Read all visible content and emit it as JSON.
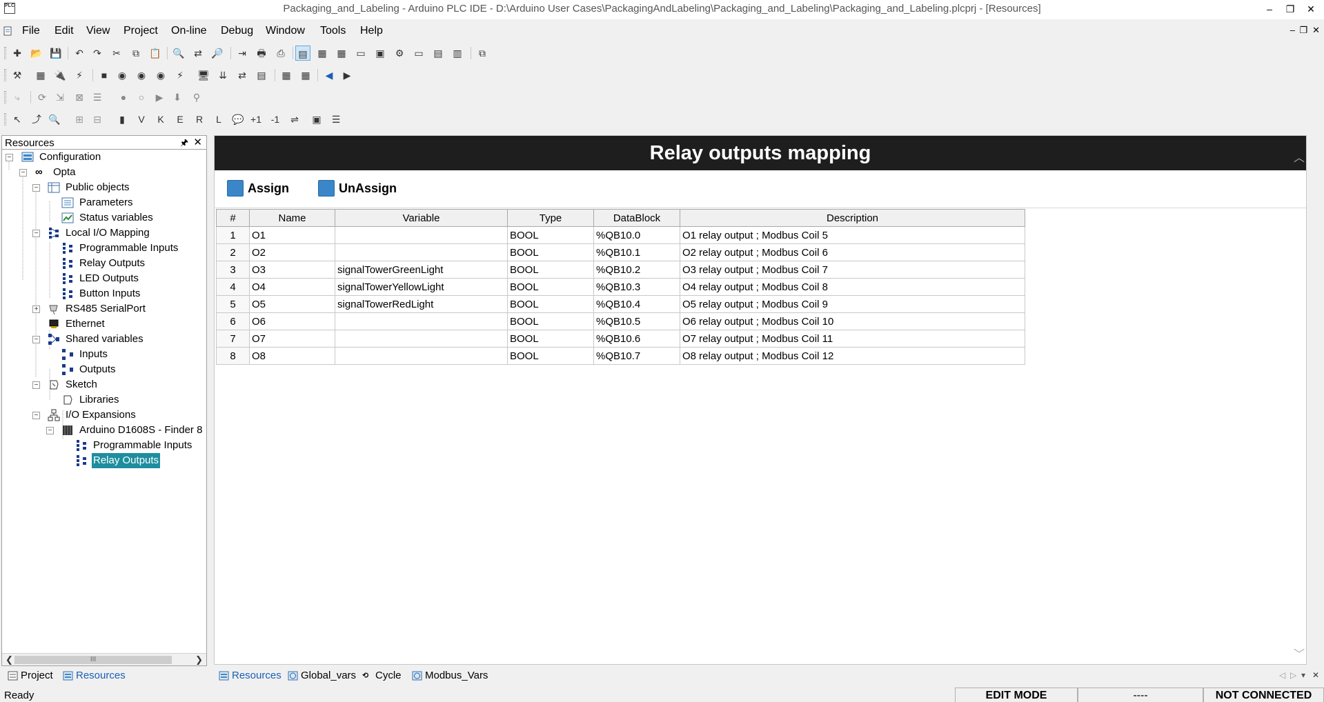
{
  "window": {
    "title": "Packaging_and_Labeling - Arduino PLC IDE - D:\\Arduino User Cases\\PackagingAndLabeling\\Packaging_and_Labeling\\Packaging_and_Labeling.plcprj - [Resources]",
    "app_icon_text": "PLC",
    "controls": {
      "minimize": "–",
      "restore": "❐",
      "close": "✕"
    },
    "mdi_controls": {
      "minimize": "–",
      "restore": "❐",
      "close": "✕"
    }
  },
  "menu": [
    "File",
    "Edit",
    "View",
    "Project",
    "On-line",
    "Debug",
    "Window",
    "Tools",
    "Help"
  ],
  "resources_panel": {
    "title": "Resources",
    "pin": "🖈",
    "close": "✕",
    "tree": [
      {
        "label": "Configuration",
        "icon": "configuration-icon"
      },
      {
        "label": "Opta",
        "icon": "infinity-icon"
      },
      {
        "label": "Public objects",
        "icon": "table-icon"
      },
      {
        "label": "Parameters",
        "icon": "list-icon"
      },
      {
        "label": "Status variables",
        "icon": "status-vars-icon"
      },
      {
        "label": "Local I/O Mapping",
        "icon": "io-mapping-icon"
      },
      {
        "label": "Programmable Inputs",
        "icon": "io-mapping-icon"
      },
      {
        "label": "Relay Outputs",
        "icon": "io-mapping-icon"
      },
      {
        "label": "LED Outputs",
        "icon": "io-mapping-icon"
      },
      {
        "label": "Button Inputs",
        "icon": "io-mapping-icon"
      },
      {
        "label": "RS485 SerialPort",
        "icon": "serial-port-icon"
      },
      {
        "label": "Ethernet",
        "icon": "ethernet-icon"
      },
      {
        "label": "Shared variables",
        "icon": "shared-vars-icon"
      },
      {
        "label": "Inputs",
        "icon": "shared-vars-icon"
      },
      {
        "label": "Outputs",
        "icon": "shared-vars-icon"
      },
      {
        "label": "Sketch",
        "icon": "sketch-icon"
      },
      {
        "label": "Libraries",
        "icon": "sketch-icon"
      },
      {
        "label": "I/O Expansions",
        "icon": "network-icon"
      },
      {
        "label": "Arduino D1608S - Finder 8",
        "icon": "module-icon"
      },
      {
        "label": "Programmable Inputs",
        "icon": "io-mapping-icon"
      },
      {
        "label": "Relay Outputs",
        "icon": "io-mapping-icon",
        "selected": true
      }
    ],
    "scroll_thumb": "III"
  },
  "left_tabs": [
    {
      "label": "Project",
      "icon": "project-icon"
    },
    {
      "label": "Resources",
      "icon": "resources-icon",
      "active": true
    }
  ],
  "editor": {
    "heading": "Relay outputs mapping",
    "assign_label": "Assign",
    "unassign_label": "UnAssign",
    "columns": [
      "#",
      "Name",
      "Variable",
      "Type",
      "DataBlock",
      "Description"
    ],
    "rows": [
      [
        "1",
        "O1",
        "",
        "BOOL",
        "%QB10.0",
        "O1 relay output ; Modbus Coil 5"
      ],
      [
        "2",
        "O2",
        "",
        "BOOL",
        "%QB10.1",
        "O2 relay output ; Modbus Coil 6"
      ],
      [
        "3",
        "O3",
        "signalTowerGreenLight",
        "BOOL",
        "%QB10.2",
        "O3 relay output ; Modbus Coil 7"
      ],
      [
        "4",
        "O4",
        "signalTowerYellowLight",
        "BOOL",
        "%QB10.3",
        "O4 relay output ; Modbus Coil 8"
      ],
      [
        "5",
        "O5",
        "signalTowerRedLight",
        "BOOL",
        "%QB10.4",
        "O5 relay output ; Modbus Coil 9"
      ],
      [
        "6",
        "O6",
        "",
        "BOOL",
        "%QB10.5",
        "O6 relay output ; Modbus Coil 10"
      ],
      [
        "7",
        "O7",
        "",
        "BOOL",
        "%QB10.6",
        "O7 relay output ; Modbus Coil 11"
      ],
      [
        "8",
        "O8",
        "",
        "BOOL",
        "%QB10.7",
        "O8 relay output ; Modbus Coil 12"
      ]
    ]
  },
  "doc_tabs": [
    {
      "label": "Resources",
      "icon": "resources-icon",
      "active": true
    },
    {
      "label": "Global_vars",
      "icon": "globe-icon"
    },
    {
      "label": "Cycle",
      "icon": "cycle-icon"
    },
    {
      "label": "Modbus_Vars",
      "icon": "globe-icon"
    }
  ],
  "doc_tab_nav": {
    "prev": "◁",
    "next": "▷",
    "menu": "▾",
    "close": "✕"
  },
  "status": {
    "text": "Ready",
    "mode": "EDIT MODE",
    "middle": "----",
    "connection": "NOT CONNECTED"
  },
  "colors": {
    "selection": "#1e8e9e",
    "banner": "#1e1e1e",
    "accent_blue": "#3a86c8"
  }
}
